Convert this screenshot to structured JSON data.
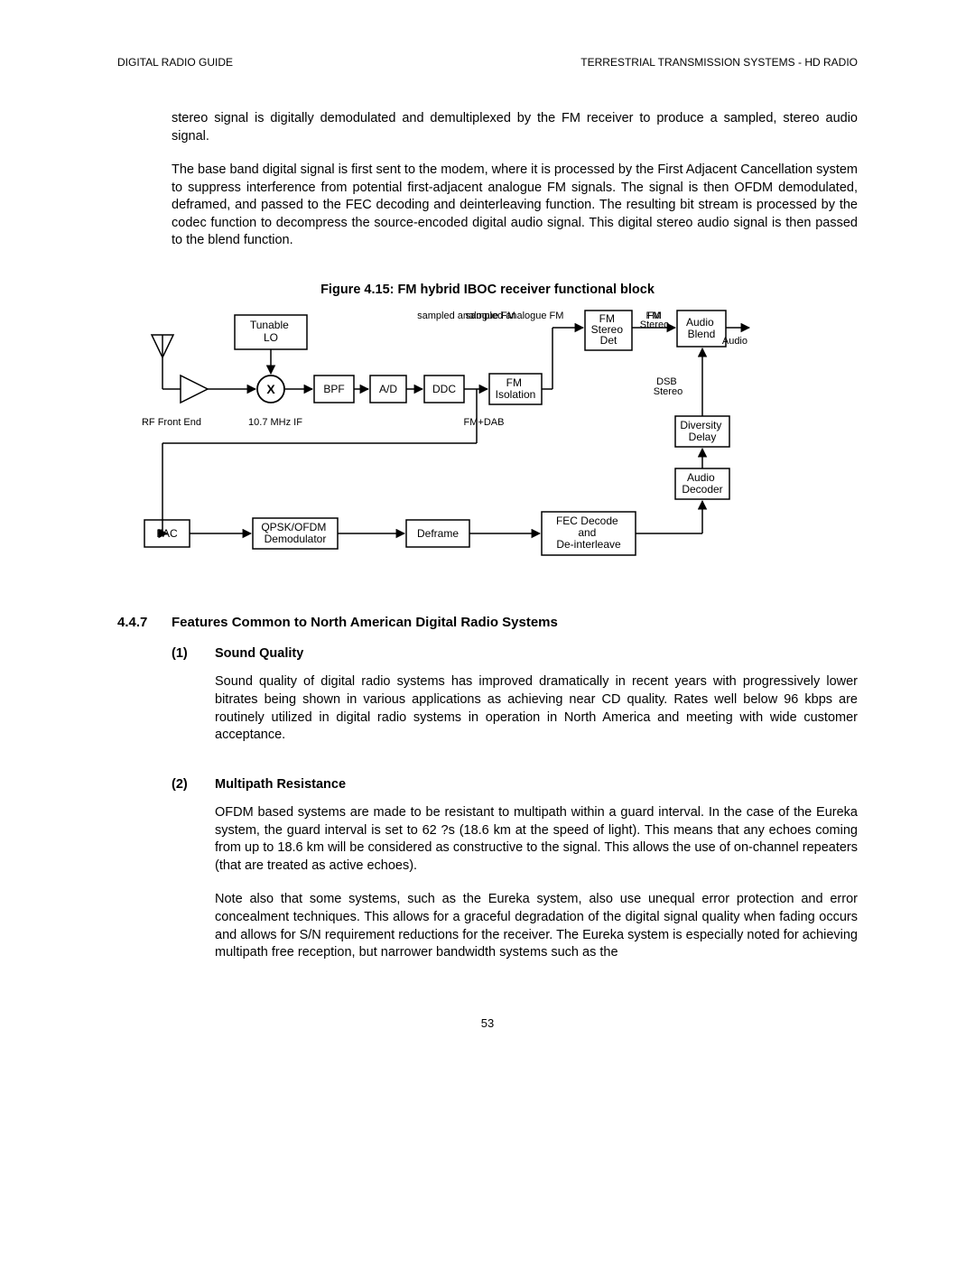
{
  "header": {
    "left": "DIGITAL RADIO GUIDE",
    "right": "TERRESTRIAL TRANSMISSION SYSTEMS - HD RADIO"
  },
  "para1": "stereo signal is digitally demodulated and demultiplexed by the FM receiver to produce a sampled, stereo audio signal.",
  "para2": "The base band digital signal is first sent to the modem, where it is processed by the First Adjacent Cancellation system to suppress interference from potential first-adjacent analogue FM signals.  The signal is then OFDM demodulated, deframed, and passed to the FEC decoding and deinterleaving function.  The resulting bit stream is processed by the codec function to decompress the source-encoded digital audio signal.  This digital stereo audio signal is then passed to the blend function.",
  "figcaption": "Figure 4.15: FM hybrid IBOC receiver functional block",
  "diagram": {
    "tunable_lo": "Tunable LO",
    "rf_front_end": "RF Front End",
    "mixer": "X",
    "if_freq": "10.7 MHz IF",
    "bpf": "BPF",
    "ad": "A/D",
    "ddc": "DDC",
    "fm_dab": "FM+DAB",
    "fm_isolation": "FM Isolation",
    "sampled_analogue_fm": "sampled analogue FM",
    "fm_stereo_det": "FM Stereo Det",
    "fm_stereo": "FM Stereo",
    "audio_blend": "Audio Blend",
    "audio": "Audio",
    "dsb_stereo": "DSB Stereo",
    "diversity_delay": "Diversity Delay",
    "audio_decoder": "Audio Decoder",
    "fac": "FAC",
    "qpsk_ofdm_demod": "QPSK/OFDM Demodulator",
    "deframe": "Deframe",
    "fec_decode": "FEC Decode and De-interleave"
  },
  "section": {
    "num": "4.4.7",
    "title": "Features Common to North American Digital Radio Systems"
  },
  "sub1": {
    "num": "(1)",
    "title": "Sound Quality",
    "body": "Sound quality of digital radio systems has improved dramatically in recent years with progressively lower bitrates being shown in various applications as achieving near CD quality.  Rates well below 96 kbps are routinely utilized in digital radio systems in operation in North America and meeting with wide customer acceptance."
  },
  "sub2": {
    "num": "(2)",
    "title": "Multipath Resistance",
    "body1": "OFDM based systems are made to be resistant to multipath within a guard interval.  In the case of the Eureka system, the guard interval is set to 62 ?s (18.6 km at the speed of light).  This means that any echoes coming from up to 18.6 km will be considered as constructive to the signal.  This allows the use of on-channel repeaters (that are treated as active echoes).",
    "body2": "Note also that some systems, such as the Eureka system, also use unequal error protection and error concealment techniques.  This allows for a graceful degradation of the digital signal quality when fading occurs and allows for S/N requirement reductions for the receiver.  The Eureka system is especially noted for achieving multipath free reception, but narrower bandwidth systems such as the"
  },
  "pagenum": "53"
}
